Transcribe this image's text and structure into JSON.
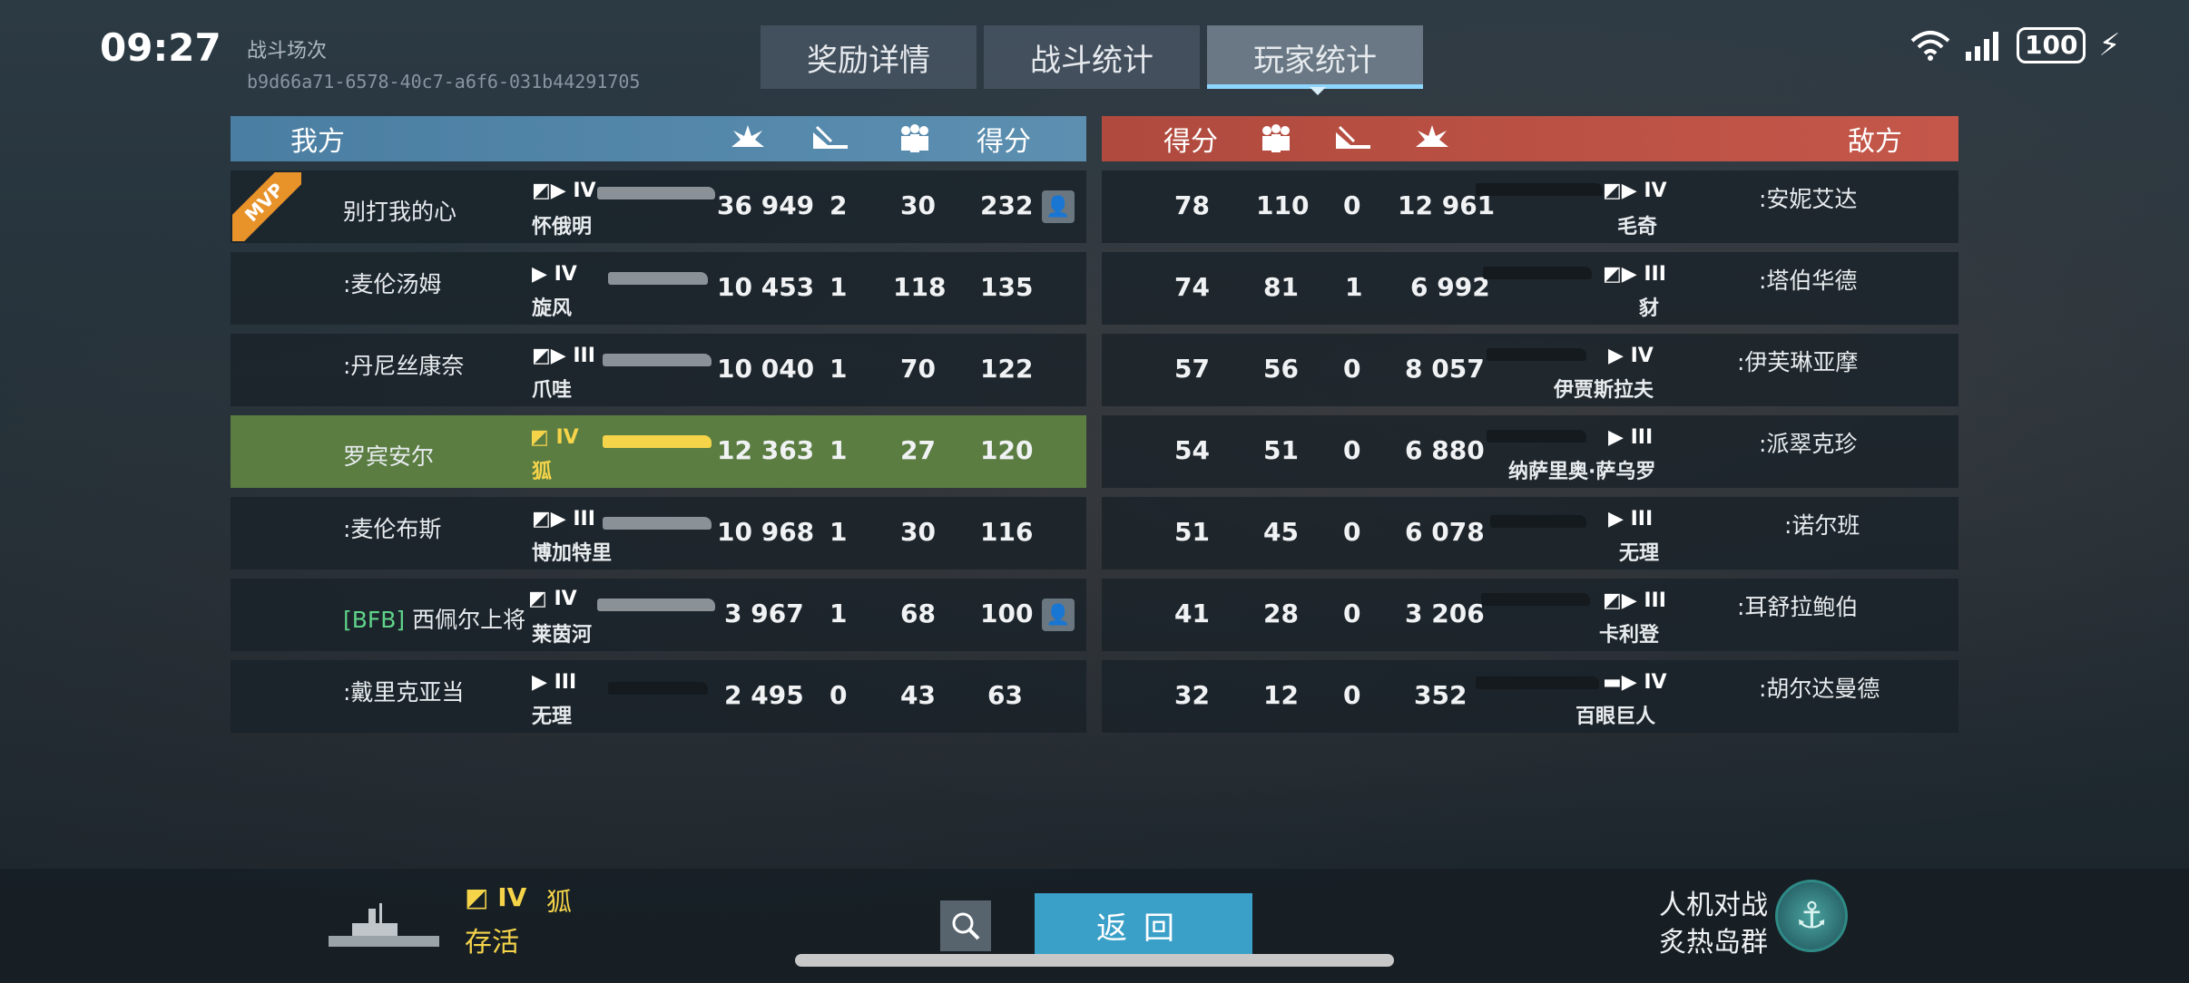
{
  "status_bar": {
    "time": "09:27",
    "battery": "100",
    "wifi_icon": "wifi-icon",
    "signal_icon": "signal-icon"
  },
  "battle": {
    "label": "战斗场次",
    "id": "b9d66a71-6578-40c7-a6f6-031b44291705"
  },
  "tabs": [
    {
      "label": "奖励详情",
      "active": false
    },
    {
      "label": "战斗统计",
      "active": false
    },
    {
      "label": "玩家统计",
      "active": true
    }
  ],
  "ally": {
    "header": {
      "title": "我方",
      "score_label": "得分",
      "col_icons": [
        "damage-icon",
        "kills-icon",
        "team-icon"
      ]
    },
    "rows": [
      {
        "name": "别打我的心",
        "tag": "",
        "tier": "IV",
        "ship": "怀俄明",
        "damage": "36 949",
        "kills": "2",
        "assist": "30",
        "score": "232",
        "mvp": true,
        "add_friend": true
      },
      {
        "name": ":麦伦汤姆",
        "tag": "",
        "tier": "IV",
        "ship": "旋风",
        "damage": "10 453",
        "kills": "1",
        "assist": "118",
        "score": "135"
      },
      {
        "name": ":丹尼丝康奈",
        "tag": "",
        "tier": "III",
        "ship": "爪哇",
        "damage": "10 040",
        "kills": "1",
        "assist": "70",
        "score": "122"
      },
      {
        "name": "罗宾安尔",
        "tag": "",
        "tier": "IV",
        "ship": "狐",
        "damage": "12 363",
        "kills": "1",
        "assist": "27",
        "score": "120",
        "self": true
      },
      {
        "name": ":麦伦布斯",
        "tag": "",
        "tier": "III",
        "ship": "博加特里",
        "damage": "10 968",
        "kills": "1",
        "assist": "30",
        "score": "116"
      },
      {
        "name": "西佩尔上将",
        "tag": "[BFB]",
        "tier": "IV",
        "ship": "莱茵河",
        "damage": "3 967",
        "kills": "1",
        "assist": "68",
        "score": "100",
        "add_friend": true
      },
      {
        "name": ":戴里克亚当",
        "tag": "",
        "tier": "III",
        "ship": "无理",
        "damage": "2 495",
        "kills": "0",
        "assist": "43",
        "score": "63"
      }
    ]
  },
  "enemy": {
    "header": {
      "title": "敌方",
      "score_label": "得分"
    },
    "rows": [
      {
        "name": ":安妮艾达",
        "tier": "IV",
        "ship": "毛奇",
        "score": "78",
        "assist": "110",
        "kills": "0",
        "damage": "12 961"
      },
      {
        "name": ":塔伯华德",
        "tier": "III",
        "ship": "豺",
        "score": "74",
        "assist": "81",
        "kills": "1",
        "damage": "6 992"
      },
      {
        "name": ":伊芙琳亚摩",
        "tier": "IV",
        "ship": "伊贾斯拉夫",
        "score": "57",
        "assist": "56",
        "kills": "0",
        "damage": "8 057"
      },
      {
        "name": ":派翠克珍",
        "tier": "III",
        "ship": "纳萨里奥·萨乌罗",
        "score": "54",
        "assist": "51",
        "kills": "0",
        "damage": "6 880"
      },
      {
        "name": ":诺尔班",
        "tier": "III",
        "ship": "无理",
        "score": "51",
        "assist": "45",
        "kills": "0",
        "damage": "6 078"
      },
      {
        "name": ":耳舒拉鲍伯",
        "tier": "III",
        "ship": "卡利登",
        "score": "41",
        "assist": "28",
        "kills": "0",
        "damage": "3 206"
      },
      {
        "name": ":胡尔达曼德",
        "tier": "IV",
        "ship": "百眼巨人",
        "score": "32",
        "assist": "12",
        "kills": "0",
        "damage": "352"
      }
    ]
  },
  "mvp_label": "MVP",
  "bottom": {
    "my_tier": "IV",
    "my_ship": "狐",
    "my_status": "存活",
    "return_label": "返回",
    "mode": "人机对战",
    "map": "炙热岛群"
  },
  "colors": {
    "ally_header": "#4a7ea2",
    "enemy_header": "#b04a3e",
    "self_row": "#5b7d42",
    "gold": "#f5d44a",
    "accent": "#3aa0c8"
  }
}
